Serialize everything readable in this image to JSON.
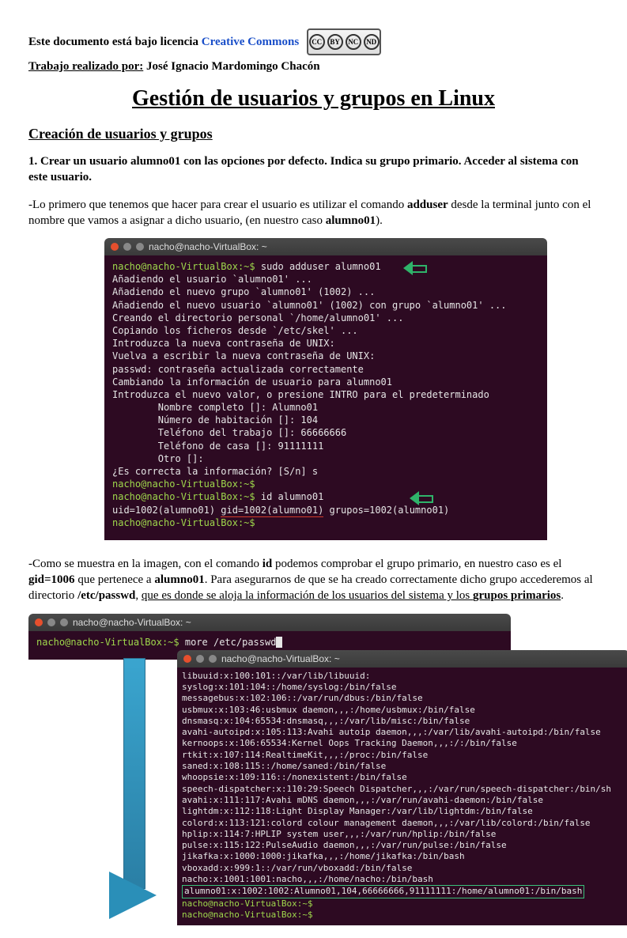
{
  "license": {
    "prefix": "Este documento está bajo licencia ",
    "link_text": "Creative Commons",
    "badge_icons": [
      "CC",
      "BY",
      "NC",
      "ND"
    ]
  },
  "author": {
    "label": "Trabajo realizado por:",
    "name": " José Ignacio Mardomingo Chacón"
  },
  "title": "Gestión de usuarios y grupos en Linux",
  "section1": "Creación de usuarios y grupos",
  "task1": "1. Crear un usuario alumno01 con las opciones por defecto. Indica su grupo primario. Acceder al sistema con este usuario.",
  "para1": {
    "t1": "-Lo primero que tenemos que hacer para crear el usuario es utilizar el comando ",
    "b1": "adduser",
    "t2": " desde la terminal junto con el nombre que vamos a asignar a dicho usuario, (en nuestro caso ",
    "b2": "alumno01",
    "t3": ")."
  },
  "terminal1": {
    "title": "nacho@nacho-VirtualBox: ~",
    "lines": {
      "l1_prompt": "nacho@nacho-VirtualBox:~$",
      "l1_cmd": " sudo adduser alumno01",
      "l2": "Añadiendo el usuario `alumno01' ...",
      "l3": "Añadiendo el nuevo grupo `alumno01' (1002) ...",
      "l4": "Añadiendo el nuevo usuario `alumno01' (1002) con grupo `alumno01' ...",
      "l5": "Creando el directorio personal `/home/alumno01' ...",
      "l6": "Copiando los ficheros desde `/etc/skel' ...",
      "l7": "Introduzca la nueva contraseña de UNIX:",
      "l8": "Vuelva a escribir la nueva contraseña de UNIX:",
      "l9": "passwd: contraseña actualizada correctamente",
      "l10": "Cambiando la información de usuario para alumno01",
      "l11": "Introduzca el nuevo valor, o presione INTRO para el predeterminado",
      "l12": "        Nombre completo []: Alumno01",
      "l13": "        Número de habitación []: 104",
      "l14": "        Teléfono del trabajo []: 66666666",
      "l15": "        Teléfono de casa []: 91111111",
      "l16": "        Otro []:",
      "l17": "¿Es correcta la información? [S/n] s",
      "l18_prompt": "nacho@nacho-VirtualBox:~$",
      "l19_prompt": "nacho@nacho-VirtualBox:~$",
      "l19_cmd": " id alumno01",
      "l20a": "uid=1002(alumno01) ",
      "l20b": "gid=1002(alumno01)",
      "l20c": " grupos=1002(alumno01)",
      "l21_prompt": "nacho@nacho-VirtualBox:~$"
    }
  },
  "para2": {
    "t1": "-Como se muestra en la imagen, con el comando ",
    "b1": "id",
    "t2": " podemos comprobar el grupo primario, en nuestro caso es el ",
    "b2": "gid=1006",
    "t3": " que pertenece a ",
    "b3": "alumno01",
    "t4": ". Para asegurarnos de que se ha creado correctamente dicho grupo accederemos al directorio ",
    "b4": "/etc/passwd",
    "t5": ", ",
    "u1": "que es donde se aloja la información de los usuarios del sistema y los ",
    "b5": "grupos primarios",
    "t6": "."
  },
  "terminal2a": {
    "title": "nacho@nacho-VirtualBox: ~",
    "prompt": "nacho@nacho-VirtualBox:~$",
    "cmd": " more /etc/passwd"
  },
  "terminal2b": {
    "title": "nacho@nacho-VirtualBox: ~",
    "lines": [
      "libuuid:x:100:101::/var/lib/libuuid:",
      "syslog:x:101:104::/home/syslog:/bin/false",
      "messagebus:x:102:106::/var/run/dbus:/bin/false",
      "usbmux:x:103:46:usbmux daemon,,,:/home/usbmux:/bin/false",
      "dnsmasq:x:104:65534:dnsmasq,,,:/var/lib/misc:/bin/false",
      "avahi-autoipd:x:105:113:Avahi autoip daemon,,,:/var/lib/avahi-autoipd:/bin/false",
      "kernoops:x:106:65534:Kernel Oops Tracking Daemon,,,:/:/bin/false",
      "rtkit:x:107:114:RealtimeKit,,,:/proc:/bin/false",
      "saned:x:108:115::/home/saned:/bin/false",
      "whoopsie:x:109:116::/nonexistent:/bin/false",
      "speech-dispatcher:x:110:29:Speech Dispatcher,,,:/var/run/speech-dispatcher:/bin/sh",
      "avahi:x:111:117:Avahi mDNS daemon,,,:/var/run/avahi-daemon:/bin/false",
      "lightdm:x:112:118:Light Display Manager:/var/lib/lightdm:/bin/false",
      "colord:x:113:121:colord colour management daemon,,,:/var/lib/colord:/bin/false",
      "hplip:x:114:7:HPLIP system user,,,:/var/run/hplip:/bin/false",
      "pulse:x:115:122:PulseAudio daemon,,,:/var/run/pulse:/bin/false",
      "jikafka:x:1000:1000:jikafka,,,:/home/jikafka:/bin/bash",
      "vboxadd:x:999:1::/var/run/vboxadd:/bin/false",
      "nacho:x:1001:1001:nacho,,,:/home/nacho:/bin/bash"
    ],
    "highlight": "alumno01:x:1002:1002:Alumno01,104,66666666,91111111:/home/alumno01:/bin/bash",
    "tail_prompt1": "nacho@nacho-VirtualBox:~$",
    "tail_prompt2": "nacho@nacho-VirtualBox:~$"
  }
}
